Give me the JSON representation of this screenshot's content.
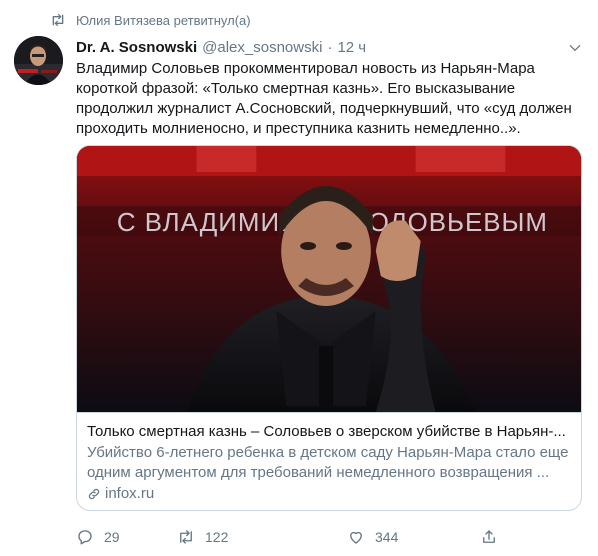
{
  "retweet_context": {
    "text": "Юлия Витязева ретвитнул(а)",
    "icon": "retweet-icon"
  },
  "author": {
    "name": "Dr. A. Sosnowski",
    "handle": "@alex_sosnowski",
    "separator": "·",
    "time": "12 ч"
  },
  "tweet": {
    "text": "Владимир Соловьев прокомментировал новость из Нарьян-Мара короткой фразой: «Только смертная казнь». Его высказывание продолжил журналист А.Сосновский, подчеркнувший, что «суд должен проходить молниеносно, и преступника казнить немедленно..»."
  },
  "card": {
    "image_caption": "С ВЛАДИМИРОМ СОЛОВЬЕВЫМ",
    "title": "Только смертная казнь – Соловьев о зверском убийстве в Нарьян-...",
    "description": "Убийство 6-летнего ребенка в детском саду Нарьян-Мара стало еще одним аргументом для требований немедленного возвращения ...",
    "domain": "infox.ru",
    "link_icon": "link-icon"
  },
  "actions": {
    "replies": "29",
    "retweets": "122",
    "likes": "344"
  },
  "colors": {
    "text": "#14171a",
    "secondary": "#657786",
    "border": "#ccd6dd",
    "accent": "#1da1f2"
  }
}
